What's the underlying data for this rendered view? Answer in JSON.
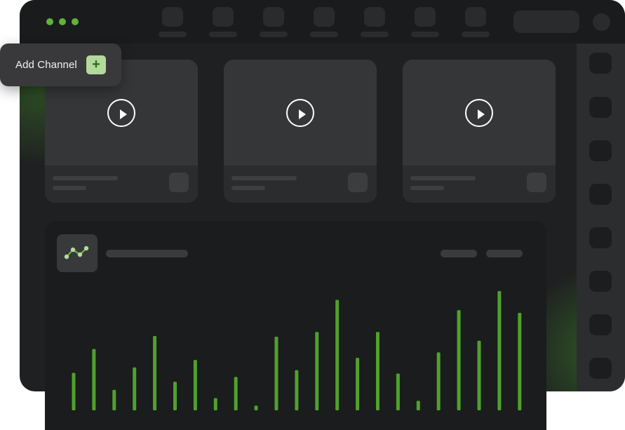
{
  "window": {
    "traffic_lights": [
      "window-dot",
      "window-dot",
      "window-dot"
    ],
    "accent_color": "#5fb43a"
  },
  "topnav": {
    "items": [
      "nav-placeholder",
      "nav-placeholder",
      "nav-placeholder",
      "nav-placeholder",
      "nav-placeholder",
      "nav-placeholder",
      "nav-placeholder"
    ]
  },
  "popover": {
    "label": "Add Channel",
    "add_icon": "+",
    "add_bg": "#b4d99c"
  },
  "cards": [
    {
      "icon": "play-icon"
    },
    {
      "icon": "play-icon"
    },
    {
      "icon": "play-icon"
    }
  ],
  "right_sidebar": {
    "buttons": 8
  },
  "analytics": {
    "icon": "trend-line-icon",
    "bar_color": "#4fa12d"
  },
  "chart_data": {
    "type": "bar",
    "values": [
      55,
      90,
      30,
      63,
      109,
      42,
      74,
      18,
      49,
      7,
      108,
      59,
      115,
      162,
      77,
      115,
      54,
      14,
      85,
      147,
      102,
      175,
      143
    ],
    "ylim": [
      0,
      180
    ],
    "grid": false
  }
}
